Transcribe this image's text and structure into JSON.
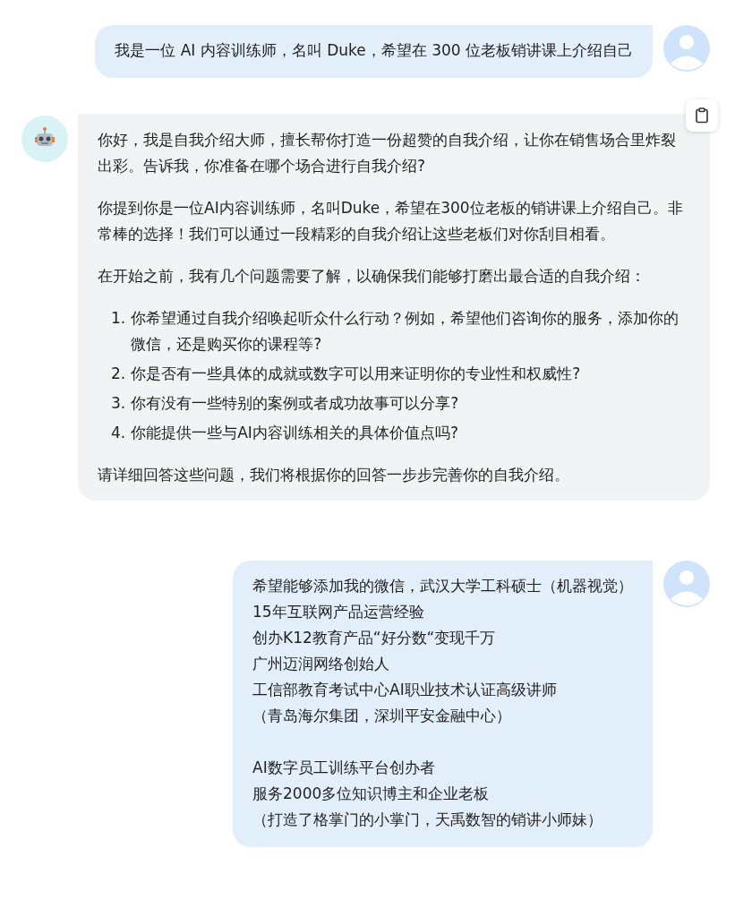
{
  "messages": [
    {
      "kind": "user",
      "groups": [
        {
          "lines": [
            "我是一位 AI 内容训练师，名叫 Duke，希望在 300 位老板销讲课上介绍自己"
          ]
        }
      ]
    },
    {
      "kind": "bot",
      "copy_button": true,
      "blocks": [
        {
          "kind": "paragraph",
          "text": "你好，我是自我介绍大师，擅长帮你打造一份超赞的自我介绍，让你在销售场合里炸裂出彩。告诉我，你准备在哪个场合进行自我介绍?"
        },
        {
          "kind": "paragraph",
          "text": "你提到你是一位AI内容训练师，名叫Duke，希望在300位老板的销讲课上介绍自己。非常棒的选择！我们可以通过一段精彩的自我介绍让这些老板们对你刮目相看。"
        },
        {
          "kind": "paragraph",
          "text": "在开始之前，我有几个问题需要了解，以确保我们能够打磨出最合适的自我介绍："
        },
        {
          "kind": "list",
          "items": [
            {
              "number": "1.",
              "text": "你希望通过自我介绍唤起听众什么行动？例如，希望他们咨询你的服务，添加你的微信，还是购买你的课程等?"
            },
            {
              "number": "2.",
              "text": "你是否有一些具体的成就或数字可以用来证明你的专业性和权威性?"
            },
            {
              "number": "3.",
              "text": "你有没有一些特别的案例或者成功故事可以分享?"
            },
            {
              "number": "4.",
              "text": "你能提供一些与AI内容训练相关的具体价值点吗?"
            }
          ]
        },
        {
          "kind": "paragraph",
          "text": "请详细回答这些问题，我们将根据你的回答一步步完善你的自我介绍。"
        }
      ]
    },
    {
      "kind": "user",
      "groups": [
        {
          "lines": [
            "希望能够添加我的微信，武汉大学工科硕士（机器视觉）",
            "15年互联网产品运营经验",
            "创办K12教育产品“好分数“变现千万",
            "广州迈润网络创始人",
            "工信部教育考试中心AI职业技术认证高级讲师",
            "（青岛海尔集团，深圳平安金融中心）"
          ]
        },
        {
          "lines": [
            "AI数字员工训练平台创办者",
            "服务2000多位知识博主和企业老板",
            "（打造了格掌门的小掌门，天禹数智的销讲小师妹）"
          ]
        }
      ]
    }
  ]
}
